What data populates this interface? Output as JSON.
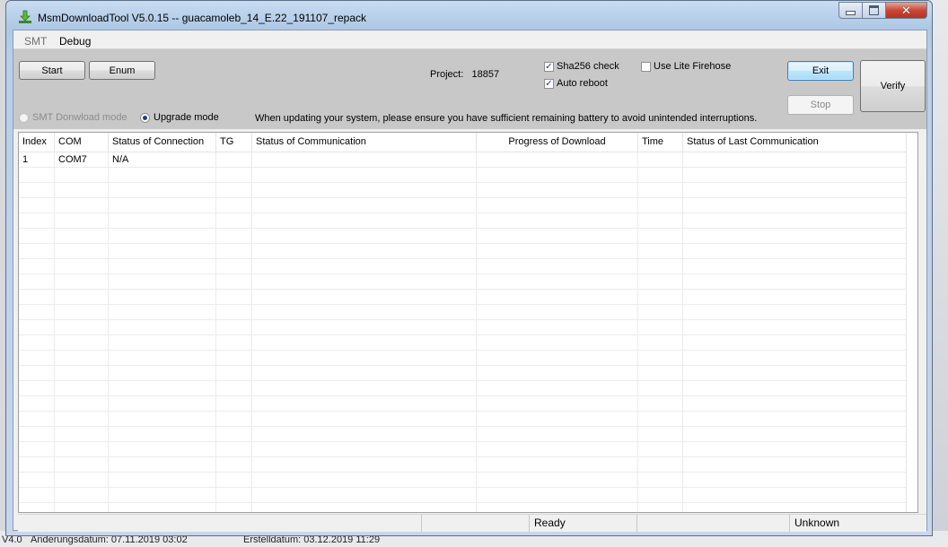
{
  "window": {
    "title": "MsmDownloadTool V5.0.15 -- guacamoleb_14_E.22_191107_repack"
  },
  "menu": {
    "items": [
      "SMT",
      "Debug"
    ]
  },
  "toolbar": {
    "start_label": "Start",
    "enum_label": "Enum",
    "project_label": "Project:",
    "project_value": "18857",
    "sha256_label": "Sha256 check",
    "sha256_checked": true,
    "auto_reboot_label": "Auto reboot",
    "auto_reboot_checked": true,
    "lite_firehose_label": "Use Lite Firehose",
    "lite_firehose_checked": false,
    "exit_label": "Exit",
    "stop_label": "Stop",
    "verify_label": "Verify"
  },
  "mode": {
    "smt_label": "SMT Donwload mode",
    "upgrade_label": "Upgrade mode",
    "selected": "upgrade",
    "warning": "When updating your system, please ensure you have sufficient remaining battery to avoid unintended interruptions."
  },
  "grid": {
    "columns": [
      "Index",
      "COM",
      "Status of Connection",
      "TG",
      "Status of Communication",
      "Progress of Download",
      "Time",
      "Status of Last Communication"
    ],
    "rows": [
      [
        "1",
        "COM7",
        "N/A",
        "",
        "",
        "",
        "",
        ""
      ]
    ]
  },
  "statusbar": {
    "panels": [
      "",
      "Ready",
      "",
      "Unknown"
    ]
  },
  "desktop": {
    "bottom_left": "V4.0",
    "bottom_mid1": "Änderungsdatum: 07.11.2019 03:02",
    "bottom_mid2": "Erstelldatum: 03.12.2019 11:29"
  },
  "colors": {
    "title_bar": "#b9cfe8",
    "toolbar_bg": "#c8c8c8",
    "close_button": "#c9473a",
    "accent": "#3c7fb1"
  }
}
